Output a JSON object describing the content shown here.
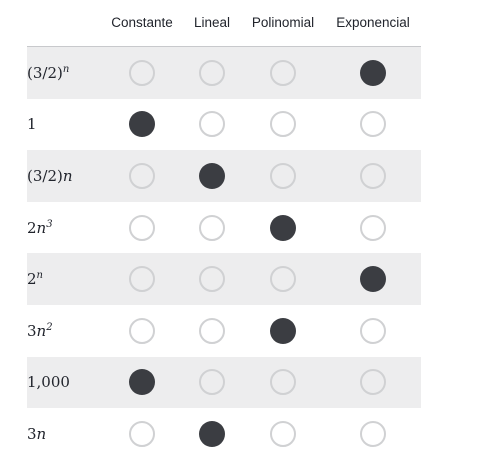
{
  "columns": [
    "Constante",
    "Lineal",
    "Polinomial",
    "Exponencial"
  ],
  "rows": [
    {
      "base": "(3/2)",
      "exp": "n",
      "suffix": "",
      "selected": 3
    },
    {
      "base": "1",
      "exp": "",
      "suffix": "",
      "selected": 0
    },
    {
      "base": "(3/2)",
      "exp": "",
      "suffix": "n",
      "selected": 1
    },
    {
      "base": "2",
      "exp": "3",
      "suffix": "n",
      "selected": 2,
      "order": "suffix-first"
    },
    {
      "base": "2",
      "exp": "n",
      "suffix": "",
      "selected": 3
    },
    {
      "base": "3",
      "exp": "2",
      "suffix": "n",
      "selected": 2,
      "order": "suffix-first"
    },
    {
      "base": "1,000",
      "exp": "",
      "suffix": "",
      "selected": 0
    },
    {
      "base": "3",
      "exp": "",
      "suffix": "n",
      "selected": 1
    }
  ],
  "colors": {
    "selected": "#3b3d42",
    "unselected_border": "#d0d1d3",
    "row_shade": "#ededee"
  }
}
